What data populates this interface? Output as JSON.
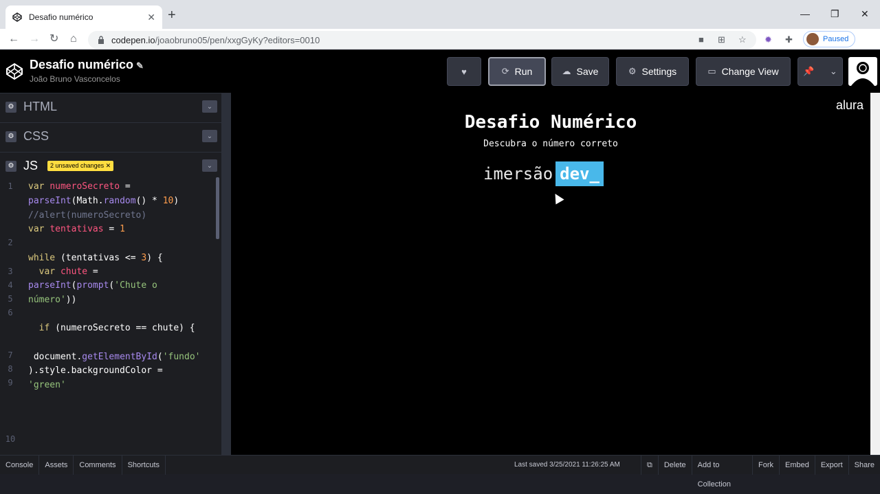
{
  "browser": {
    "tab_title": "Desafio numérico",
    "tab_close": "✕",
    "new_tab": "+",
    "url_host": "codepen.io",
    "url_path": "/joaobruno05/pen/xxgGyKy?editors=0010",
    "profile_status": "Paused"
  },
  "pen": {
    "title": "Desafio numérico",
    "author": "João Bruno Vasconcelos"
  },
  "toolbar": {
    "run_label": "Run",
    "save_label": "Save",
    "settings_label": "Settings",
    "change_view_label": "Change View"
  },
  "panels": {
    "html_label": "HTML",
    "css_label": "CSS",
    "js_label": "JS",
    "unsaved_badge": "2 unsaved changes"
  },
  "code": {
    "line_numbers": [
      "1",
      "2",
      "3",
      "4",
      "5",
      "6",
      "7",
      "8",
      "9",
      "10"
    ]
  },
  "preview": {
    "title": "Desafio Numérico",
    "subtitle": "Descubra o número correto",
    "brand_word1": "imersão",
    "brand_word2": "dev_",
    "logo_text": "alura"
  },
  "footer": {
    "console": "Console",
    "assets": "Assets",
    "comments": "Comments",
    "shortcuts": "Shortcuts",
    "last_saved": "Last saved 3/25/2021 11:26:25 AM",
    "delete": "Delete",
    "add_to_collection": "Add to Collection",
    "fork": "Fork",
    "embed": "Embed",
    "export": "Export",
    "share": "Share"
  }
}
